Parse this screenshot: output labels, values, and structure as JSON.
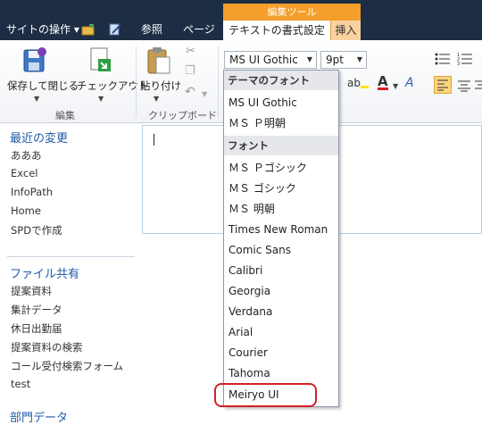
{
  "topbar": {
    "site_actions": "サイトの操作 ▾",
    "tab_browse": "参照",
    "tab_page": "ページ",
    "context_group": "編集ツール",
    "tab_format_text": "テキストの書式設定",
    "tab_insert": "挿入"
  },
  "ribbon": {
    "save_close": "保存して閉じる",
    "checkout": "チェックアウト",
    "paste": "貼り付け",
    "group_edit": "編集",
    "group_clipboard": "クリップボード",
    "font_value": "MS UI Gothic",
    "size_value": "9pt"
  },
  "nav": {
    "recent_heading": "最近の変更",
    "recent_items": [
      "あああ",
      "Excel",
      "InfoPath",
      "Home",
      "SPDで作成"
    ],
    "shared_heading": "ファイル共有",
    "shared_items": [
      "提案資料",
      "集計データ",
      "休日出勤届",
      "提案資料の検索",
      "コール受付検索フォーム",
      "test"
    ],
    "dept_heading": "部門データ"
  },
  "font_menu": {
    "theme_heading": "テーマのフォント",
    "theme_fonts": [
      "MS UI Gothic",
      "ＭＳ Ｐ明朝"
    ],
    "fonts_heading": "フォント",
    "fonts": [
      "ＭＳ Ｐゴシック",
      "ＭＳ ゴシック",
      "ＭＳ 明朝",
      "Times New Roman",
      "Comic Sans",
      "Calibri",
      "Georgia",
      "Verdana",
      "Arial",
      "Courier",
      "Tahoma",
      "Meiryo UI"
    ]
  },
  "colors": {
    "topbar": "#1d2d44",
    "context_orange": "#f49e2b",
    "link_blue": "#1f5aa6",
    "highlight_red": "#d4202a"
  }
}
